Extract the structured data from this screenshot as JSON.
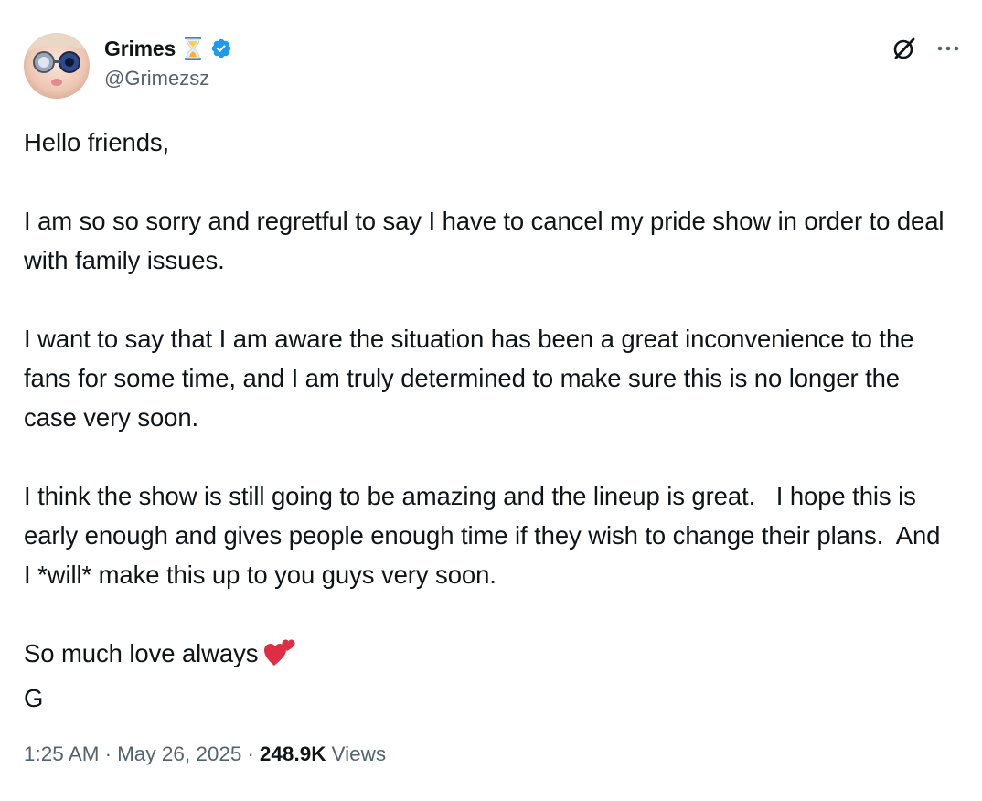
{
  "author": {
    "display_name": "Grimes",
    "handle": "@Grimezsz",
    "name_emoji": "hourglass-icon",
    "verified": true,
    "verified_color": "#1d9bf0"
  },
  "actions": {
    "grok_icon": "grok-icon",
    "more_icon": "more-icon"
  },
  "post": {
    "paragraphs": [
      "Hello friends,",
      "I am so so sorry and regretful to say I have to cancel my pride show in order to deal with family issues.",
      "I want to say that I am aware the situation has been a great inconvenience to the fans for some time, and I am truly determined to make sure this is no longer the case very soon.",
      "I think the show is still going to be amazing and the lineup is great.   I hope this is early enough and gives people enough time if they wish to change their plans.  And I *will* make this up to you guys very soon.",
      "So much love always",
      "G"
    ],
    "closing_emoji": "two-hearts-icon"
  },
  "meta": {
    "time": "1:25 AM",
    "date": "May 26, 2025",
    "separator": "·",
    "views_count": "248.9K",
    "views_label": "Views"
  },
  "colors": {
    "text": "#0f1419",
    "secondary": "#536471",
    "accent": "#1d9bf0",
    "heart": "#e0245e"
  }
}
